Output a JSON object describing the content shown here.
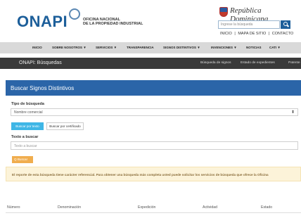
{
  "header": {
    "logo_text": "ONAPI",
    "logo_sub1": "OFICINA NACIONAL",
    "logo_sub2": "DE LA PROPIEDAD INDUSTRIAL",
    "gov_text": "República Dominicana",
    "search_placeholder": "Ingrese la búsqueda",
    "top_links": [
      "INICIO",
      "|",
      "MAPA DE SITIO",
      "|",
      "CONTACTO"
    ]
  },
  "nav": {
    "items": [
      "INICIO",
      "SOBRE NOSOTROS ▼",
      "SERVICIOS ▼",
      "TRANSPARENCIA",
      "SIGNOS DISTINTIVOS ▼",
      "INVENCIONES ▼",
      "NOTICIAS",
      "CATI ▼"
    ]
  },
  "subbar": {
    "title": "ONAPI: Búsquedas",
    "links": [
      "Búsqueda de signos",
      "Estado de expedientes",
      "Patente"
    ]
  },
  "panel": {
    "title": "Buscar Signos Distintivos"
  },
  "form": {
    "tipo_label": "Tipo de búsqueda",
    "tipo_value": "Nombre comercial",
    "tab_text": "Buscar por texto",
    "tab_cert": "Buscar por certificado",
    "texto_label": "Texto a buscar",
    "texto_placeholder": "Texto a buscar",
    "search_button": "Q Buscar"
  },
  "alert": {
    "text": "El reporte de esta búsqueda tiene carácter referencial. Para obtener una búsqueda más completa usted puede solicitar los servicios de búsqueda que ofrece la Oficina"
  },
  "table": {
    "headers": [
      "Número",
      "Denominación",
      "Expedición",
      "Actividad",
      "Estado"
    ]
  },
  "colors": {
    "brand": "#1d5f9a",
    "panel": "#2b65a8",
    "tab_active": "#3fb6e6",
    "search_button": "#f0ad4e",
    "alert_bg": "#fcf3d9"
  }
}
